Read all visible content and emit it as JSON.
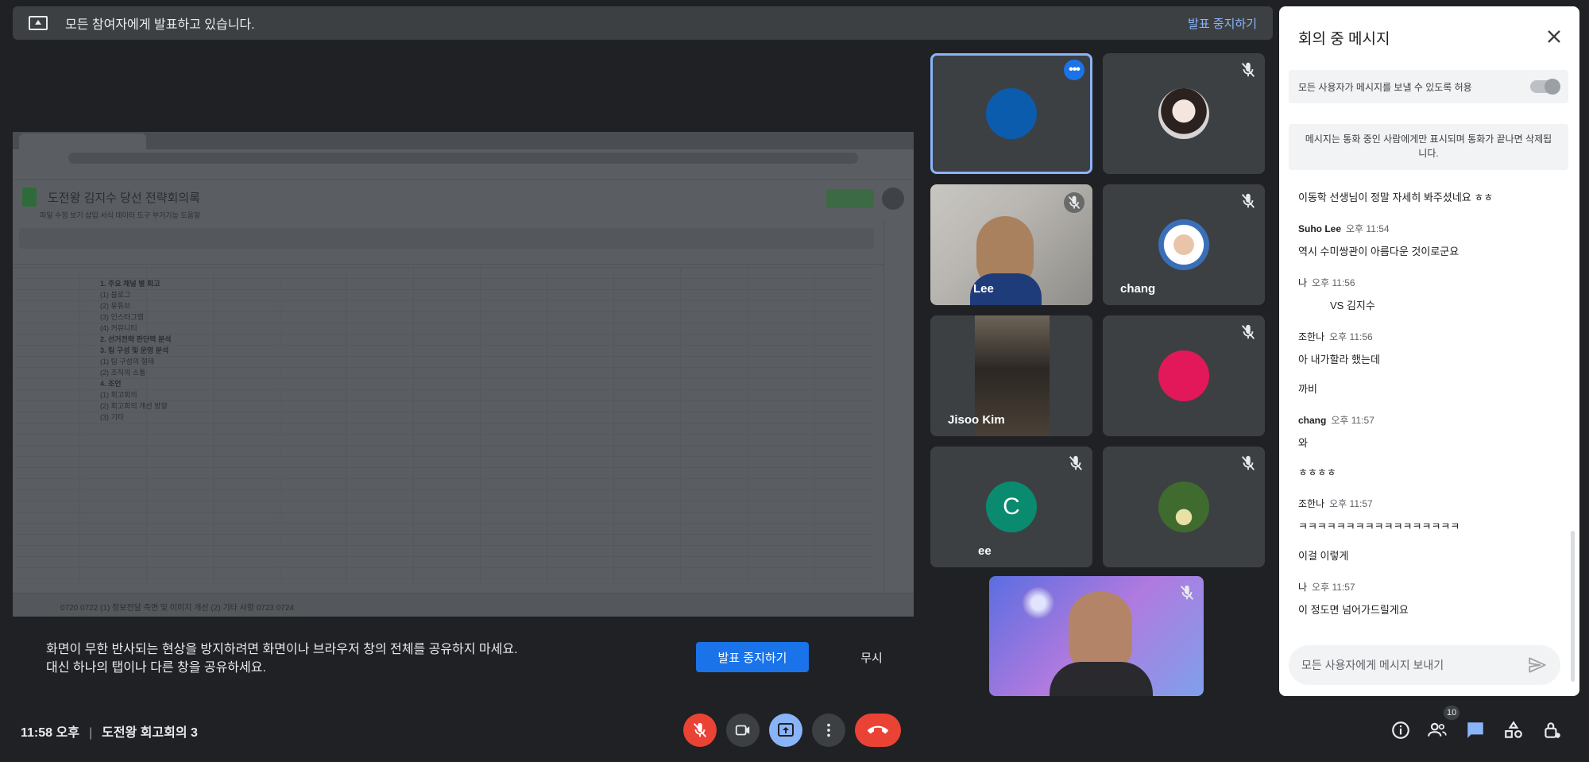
{
  "banner": {
    "text": "모든 참여자에게 발표하고 있습니다.",
    "stop_link": "발표 중지하기"
  },
  "shared_screen": {
    "doc_title": "도전왕 김지수 당선 전략회의록",
    "menus": "파일   수정   보기   삽입   서식   데이터   도구   부가기능   도움말",
    "lines": [
      "1. 주요 채널 별 회고",
      "(1) 블로그",
      "(2) 유튜브",
      "(3) 인스타그램",
      "(4) 커뮤니티",
      "",
      "2. 선거전략 판단력 분석",
      "",
      "3. 팀 구성 및 운영 분석",
      "(1) 팀 구성의 형태",
      "(2) 조직의 소통",
      "",
      "4. 조언",
      "(1) 회고회의",
      "(2) 회고회의 개선 방향",
      "(3) 기타"
    ],
    "sheet_tabs": "0720    0722    (1) 정보전달 측면 및 이미지 개선    (2) 기타 사항    0723    0724"
  },
  "warning": {
    "line1": "화면이 무한 반사되는 현상을 방지하려면 화면이나 브라우저 창의 전체를 공유하지 마세요.",
    "line2": "대신 하나의 탭이나 다른 창을 공유하세요.",
    "stop_button": "발표 중지하기",
    "dismiss_button": "무시"
  },
  "tiles": {
    "self_top": {
      "more": "•••",
      "avatar_color": "#0b5cad"
    },
    "woman": {
      "name": ""
    },
    "lee": {
      "name": "Lee"
    },
    "chang": {
      "name": "chang"
    },
    "jisoo": {
      "name": "Jisoo Kim"
    },
    "pink": {
      "avatar_color": "#e2185b"
    },
    "ee": {
      "name": "ee",
      "initial": "C",
      "avatar_color": "#0a8a6e"
    },
    "green": {
      "avatar_color": "#3f6b2e"
    }
  },
  "bottom": {
    "time": "11:58 오후",
    "meeting_name": "도전왕 회고회의 3",
    "participants_count": "10"
  },
  "chat": {
    "title": "회의 중 메시지",
    "allow_label": "모든 사용자가 메시지를 보낼 수 있도록 허용",
    "notice": "메시지는 통화 중인 사람에게만 표시되며 통화가 끝나면 삭제됩니다.",
    "messages": [
      {
        "sender": "",
        "time": "",
        "body": "이동학 선생님이 정말 자세히 봐주셨네요 ㅎㅎ"
      },
      {
        "sender": "Suho Lee",
        "time": "오후 11:54",
        "body": "역시 수미쌍관이 아름다운 것이로군요"
      },
      {
        "sender": "나",
        "time": "오후 11:56",
        "body": "VS 김지수",
        "indent": true
      },
      {
        "sender": "조한나",
        "time": "오후 11:56",
        "body": "아 내가할라 했는데"
      },
      {
        "sender": "",
        "time": "",
        "body": "까비"
      },
      {
        "sender": "chang",
        "time": "오후 11:57",
        "body": "와"
      },
      {
        "sender": "",
        "time": "",
        "body": "ㅎㅎㅎㅎ"
      },
      {
        "sender": "조한나",
        "time": "오후 11:57",
        "body": "ㅋㅋㅋㅋㅋㅋㅋㅋㅋㅋㅋㅋㅋㅋㅋㅋㅋ"
      },
      {
        "sender": "",
        "time": "",
        "body": "이걸 이렇게"
      },
      {
        "sender": "나",
        "time": "오후 11:57",
        "body": "이 정도면 넘어가드릴게요"
      }
    ],
    "input_placeholder": "모든 사용자에게 메시지 보내기"
  },
  "colors": {
    "background": "#202124",
    "accent": "#1a73e8",
    "danger": "#ea4335",
    "link": "#8ab4f8"
  }
}
